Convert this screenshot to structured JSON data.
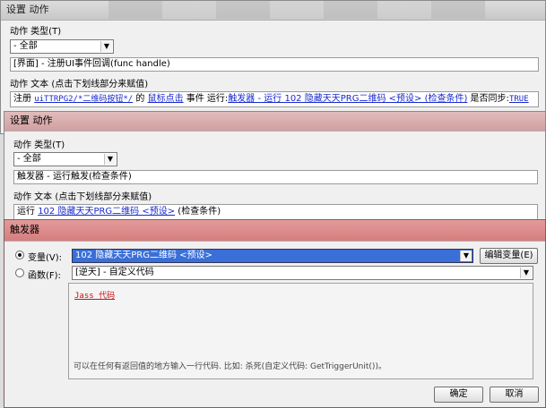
{
  "window1": {
    "title": "设置 动作",
    "action_type_label": "动作 类型(T)",
    "action_type_value": "- 全部",
    "action_selected": "[界面] - 注册UI事件回调(func handle)",
    "action_text_label": "动作 文本 (点击下划线部分来赋值)",
    "text_parts": {
      "p1": "注册 ",
      "p2": "uiTTRPG2/*二维码按钮*/",
      "p3": " 的 ",
      "p4": "鼠标点击",
      "p5": " 事件 运行:",
      "p6": "触发器 - 运行 102 隐藏天天PRG二维码 <预设> (检查条件)",
      "p7": " 是否同步:",
      "p8": "TRUE"
    }
  },
  "window2": {
    "title": "设置 动作",
    "action_type_label": "动作 类型(T)",
    "action_type_value": "- 全部",
    "action_selected": "触发器 - 运行触发(检查条件)",
    "action_text_label": "动作 文本 (点击下划线部分来赋值)",
    "text_parts": {
      "p1": "运行 ",
      "p2": "102 隐藏天天PRG二维码 <预设>",
      "p3": " (检查条件)"
    }
  },
  "window3": {
    "title": "触发器",
    "variable_label": "变量(V):",
    "variable_value": "102 隐藏天天PRG二维码 <预设>",
    "edit_variable_button": "编辑变量(E)",
    "function_label": "函数(F):",
    "function_value": "[逆天] - 自定义代码",
    "jass_link": "Jass 代码",
    "hint_text": "可以在任何有返回值的地方输入一行代码. 比如: 杀死(自定义代码: GetTriggerUnit())。",
    "ok_button": "确定",
    "cancel_button": "取消"
  }
}
